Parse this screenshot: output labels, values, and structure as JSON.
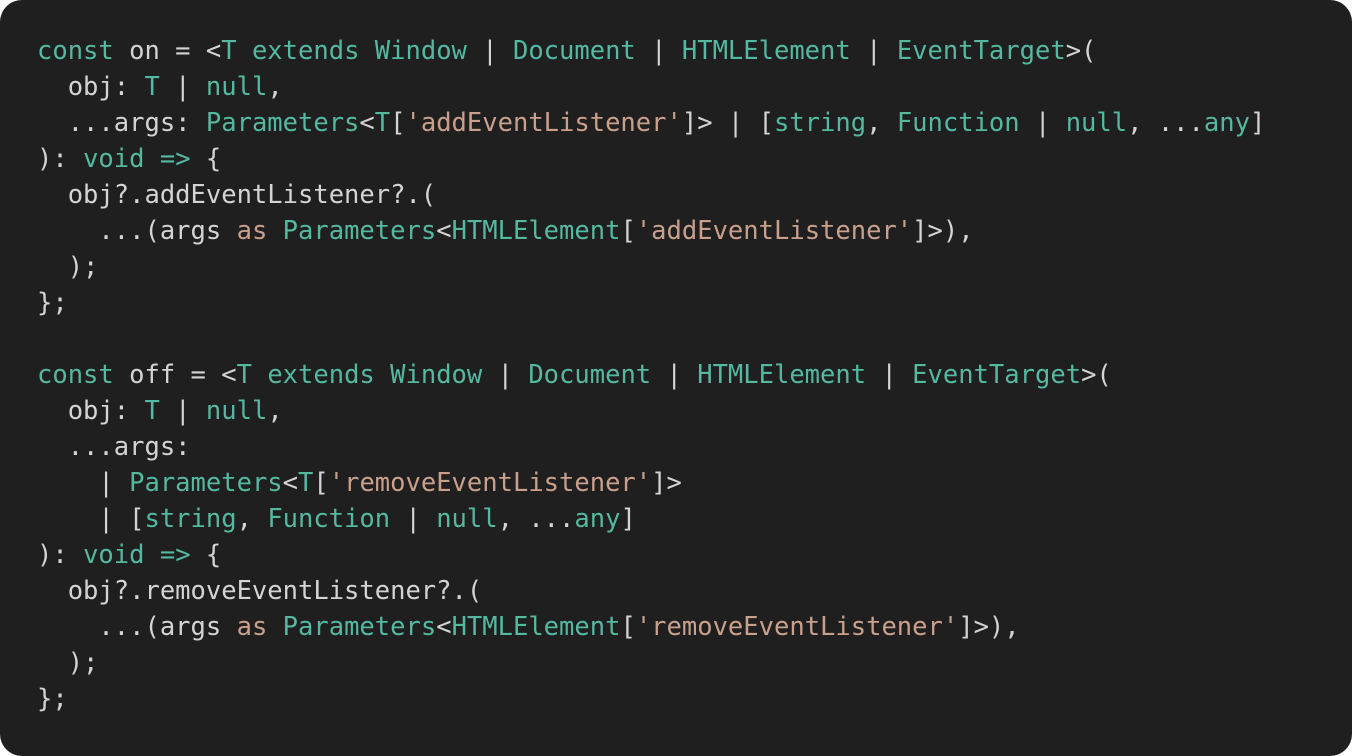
{
  "colors": {
    "background": "#1f1f1f",
    "plain": "#d4d4d4",
    "keyword": "#54b9a0",
    "type": "#54b9a0",
    "string": "#c9a08c"
  },
  "lines": [
    [
      {
        "t": "kw",
        "s": "const"
      },
      {
        "t": "plain",
        "s": " on = <"
      },
      {
        "t": "type",
        "s": "T"
      },
      {
        "t": "plain",
        "s": " "
      },
      {
        "t": "kw",
        "s": "extends"
      },
      {
        "t": "plain",
        "s": " "
      },
      {
        "t": "type",
        "s": "Window"
      },
      {
        "t": "plain",
        "s": " | "
      },
      {
        "t": "type",
        "s": "Document"
      },
      {
        "t": "plain",
        "s": " | "
      },
      {
        "t": "type",
        "s": "HTMLElement"
      },
      {
        "t": "plain",
        "s": " | "
      },
      {
        "t": "type",
        "s": "EventTarget"
      },
      {
        "t": "plain",
        "s": ">("
      }
    ],
    [
      {
        "t": "plain",
        "s": "  obj: "
      },
      {
        "t": "type",
        "s": "T"
      },
      {
        "t": "plain",
        "s": " | "
      },
      {
        "t": "kw",
        "s": "null"
      },
      {
        "t": "plain",
        "s": ","
      }
    ],
    [
      {
        "t": "plain",
        "s": "  ...args: "
      },
      {
        "t": "type",
        "s": "Parameters"
      },
      {
        "t": "plain",
        "s": "<"
      },
      {
        "t": "type",
        "s": "T"
      },
      {
        "t": "plain",
        "s": "["
      },
      {
        "t": "str",
        "s": "'addEventListener'"
      },
      {
        "t": "plain",
        "s": "]> | ["
      },
      {
        "t": "kw",
        "s": "string"
      },
      {
        "t": "plain",
        "s": ", "
      },
      {
        "t": "type",
        "s": "Function"
      },
      {
        "t": "plain",
        "s": " | "
      },
      {
        "t": "kw",
        "s": "null"
      },
      {
        "t": "plain",
        "s": ", ..."
      },
      {
        "t": "kw",
        "s": "any"
      },
      {
        "t": "plain",
        "s": "]"
      }
    ],
    [
      {
        "t": "plain",
        "s": "): "
      },
      {
        "t": "kw",
        "s": "void"
      },
      {
        "t": "plain",
        "s": " "
      },
      {
        "t": "kw",
        "s": "=>"
      },
      {
        "t": "plain",
        "s": " {"
      }
    ],
    [
      {
        "t": "plain",
        "s": "  obj?.addEventListener?.("
      }
    ],
    [
      {
        "t": "plain",
        "s": "    ...(args "
      },
      {
        "t": "str",
        "s": "as"
      },
      {
        "t": "plain",
        "s": " "
      },
      {
        "t": "type",
        "s": "Parameters"
      },
      {
        "t": "plain",
        "s": "<"
      },
      {
        "t": "type",
        "s": "HTMLElement"
      },
      {
        "t": "plain",
        "s": "["
      },
      {
        "t": "str",
        "s": "'addEventListener'"
      },
      {
        "t": "plain",
        "s": "]>),"
      }
    ],
    [
      {
        "t": "plain",
        "s": "  );"
      }
    ],
    [
      {
        "t": "plain",
        "s": "};"
      }
    ],
    [],
    [
      {
        "t": "kw",
        "s": "const"
      },
      {
        "t": "plain",
        "s": " off = <"
      },
      {
        "t": "type",
        "s": "T"
      },
      {
        "t": "plain",
        "s": " "
      },
      {
        "t": "kw",
        "s": "extends"
      },
      {
        "t": "plain",
        "s": " "
      },
      {
        "t": "type",
        "s": "Window"
      },
      {
        "t": "plain",
        "s": " | "
      },
      {
        "t": "type",
        "s": "Document"
      },
      {
        "t": "plain",
        "s": " | "
      },
      {
        "t": "type",
        "s": "HTMLElement"
      },
      {
        "t": "plain",
        "s": " | "
      },
      {
        "t": "type",
        "s": "EventTarget"
      },
      {
        "t": "plain",
        "s": ">("
      }
    ],
    [
      {
        "t": "plain",
        "s": "  obj: "
      },
      {
        "t": "type",
        "s": "T"
      },
      {
        "t": "plain",
        "s": " | "
      },
      {
        "t": "kw",
        "s": "null"
      },
      {
        "t": "plain",
        "s": ","
      }
    ],
    [
      {
        "t": "plain",
        "s": "  ...args:"
      }
    ],
    [
      {
        "t": "plain",
        "s": "    | "
      },
      {
        "t": "type",
        "s": "Parameters"
      },
      {
        "t": "plain",
        "s": "<"
      },
      {
        "t": "type",
        "s": "T"
      },
      {
        "t": "plain",
        "s": "["
      },
      {
        "t": "str",
        "s": "'removeEventListener'"
      },
      {
        "t": "plain",
        "s": "]>"
      }
    ],
    [
      {
        "t": "plain",
        "s": "    | ["
      },
      {
        "t": "kw",
        "s": "string"
      },
      {
        "t": "plain",
        "s": ", "
      },
      {
        "t": "type",
        "s": "Function"
      },
      {
        "t": "plain",
        "s": " | "
      },
      {
        "t": "kw",
        "s": "null"
      },
      {
        "t": "plain",
        "s": ", ..."
      },
      {
        "t": "kw",
        "s": "any"
      },
      {
        "t": "plain",
        "s": "]"
      }
    ],
    [
      {
        "t": "plain",
        "s": "): "
      },
      {
        "t": "kw",
        "s": "void"
      },
      {
        "t": "plain",
        "s": " "
      },
      {
        "t": "kw",
        "s": "=>"
      },
      {
        "t": "plain",
        "s": " {"
      }
    ],
    [
      {
        "t": "plain",
        "s": "  obj?.removeEventListener?.("
      }
    ],
    [
      {
        "t": "plain",
        "s": "    ...(args "
      },
      {
        "t": "str",
        "s": "as"
      },
      {
        "t": "plain",
        "s": " "
      },
      {
        "t": "type",
        "s": "Parameters"
      },
      {
        "t": "plain",
        "s": "<"
      },
      {
        "t": "type",
        "s": "HTMLElement"
      },
      {
        "t": "plain",
        "s": "["
      },
      {
        "t": "str",
        "s": "'removeEventListener'"
      },
      {
        "t": "plain",
        "s": "]>),"
      }
    ],
    [
      {
        "t": "plain",
        "s": "  );"
      }
    ],
    [
      {
        "t": "plain",
        "s": "};"
      }
    ]
  ]
}
